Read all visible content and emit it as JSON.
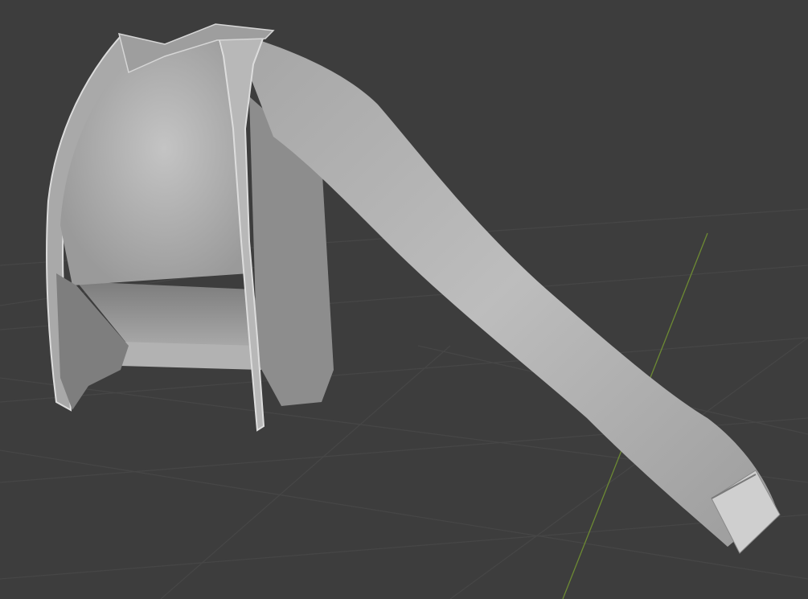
{
  "viewport": {
    "background_color": "#3d3d3d",
    "grid_color": "#4a4a4a",
    "axis_y_color": "#7a9a3a",
    "mesh_color": "#9c9c9c",
    "mesh_highlight": "#c6c6c6",
    "mesh_shadow": "#6a6a6a"
  },
  "scene": {
    "object_name": "jacket-with-single-sleeve-mesh",
    "shading": "solid"
  }
}
